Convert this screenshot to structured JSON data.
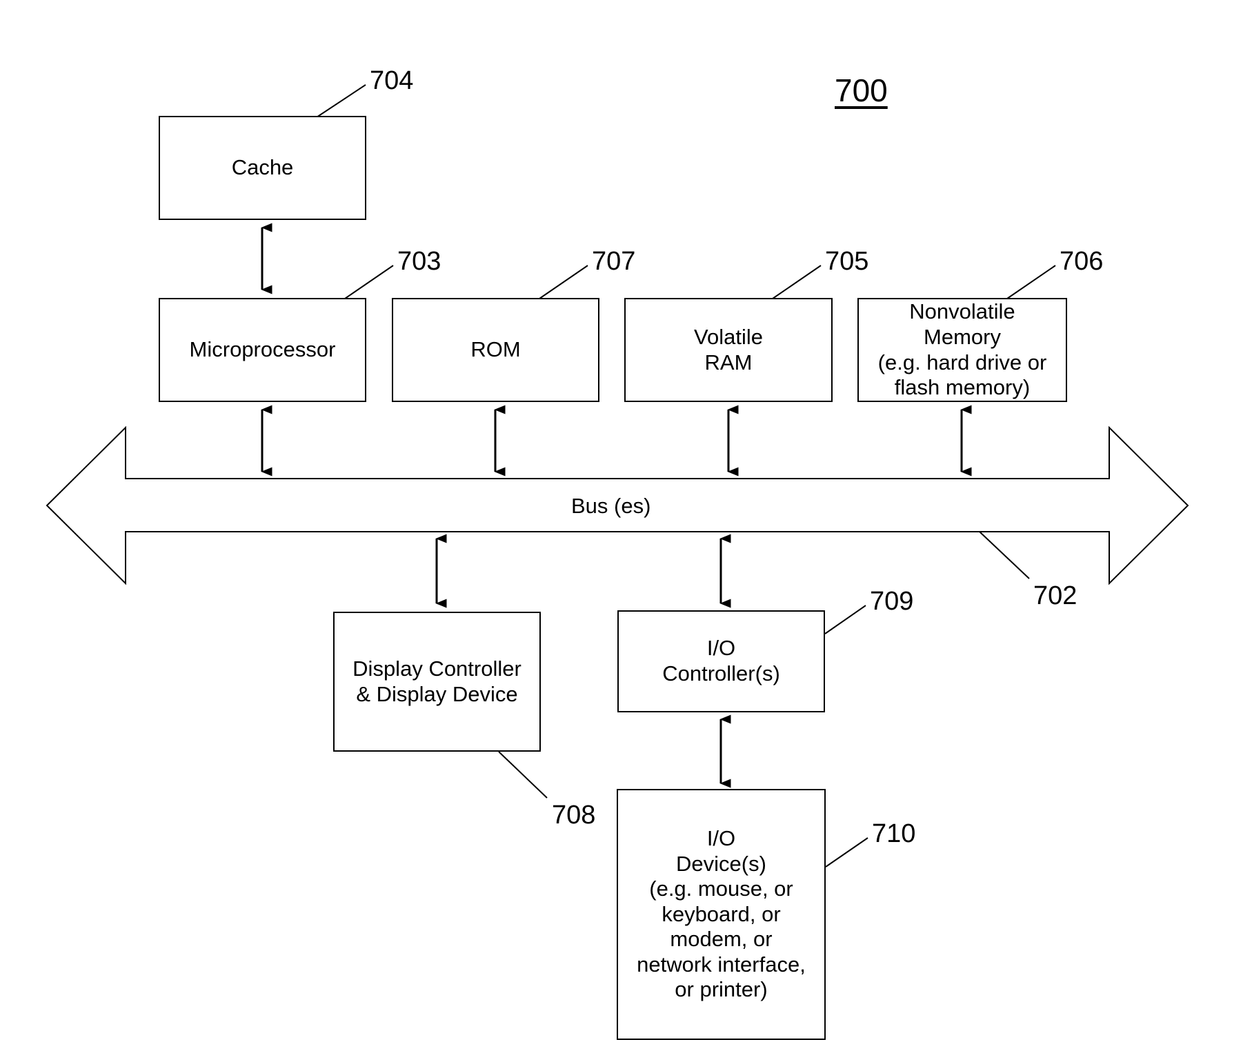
{
  "figure": {
    "number": "700",
    "type": "block-diagram",
    "description": "Data processing system block diagram"
  },
  "blocks": [
    {
      "id": "cache",
      "label": "Cache",
      "ref": "704"
    },
    {
      "id": "micro",
      "label": "Microprocessor",
      "ref": "703"
    },
    {
      "id": "rom",
      "label": "ROM",
      "ref": "707"
    },
    {
      "id": "vram",
      "label": "Volatile\nRAM",
      "ref": "705"
    },
    {
      "id": "nvmem",
      "label": "Nonvolatile\nMemory\n(e.g. hard drive or\nflash memory)",
      "ref": "706"
    },
    {
      "id": "display",
      "label": "Display Controller\n& Display Device",
      "ref": "708"
    },
    {
      "id": "ioctrl",
      "label": "I/O\nController(s)",
      "ref": "709"
    },
    {
      "id": "iodev",
      "label": "I/O\nDevice(s)\n(e.g. mouse, or\nkeyboard, or\nmodem, or\nnetwork interface,\nor printer)",
      "ref": "710"
    }
  ],
  "bus": {
    "label": "Bus (es)",
    "ref": "702"
  },
  "refs": {
    "cache": "704",
    "micro": "703",
    "rom": "707",
    "vram": "705",
    "nvmem": "706",
    "bus": "702",
    "display": "708",
    "ioctrl": "709",
    "iodev": "710"
  },
  "colors": {
    "stroke": "#000000",
    "fill": "#ffffff",
    "text": "#000000"
  }
}
